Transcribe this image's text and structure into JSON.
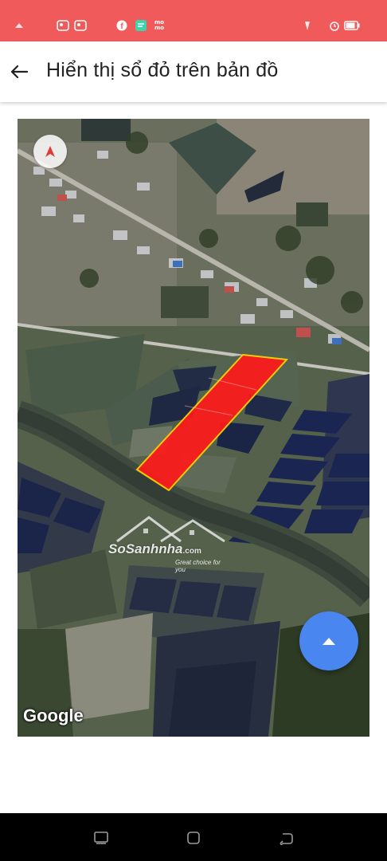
{
  "status_bar": {
    "background": "#f15a5a",
    "left_icons": [
      "notification-icon",
      "photo-icon",
      "photo-icon",
      "facebook-icon",
      "message-icon",
      "momo-icon"
    ],
    "momo_label": "mo\nmo",
    "right_icons": [
      "vpn-key-icon",
      "alarm-icon",
      "battery-icon"
    ]
  },
  "app_bar": {
    "back_icon": "arrow-left-icon",
    "title": "Hiển thị sổ đỏ trên bản đồ"
  },
  "map": {
    "view": "satellite",
    "compass_icon": "compass-icon",
    "google_logo": "Google",
    "watermark": {
      "brand": "SoSanhnha",
      "domain": ".com",
      "tagline": "Great choice for you"
    },
    "parcel_fill": "#ff1a1a",
    "parcel_border": "#ffd400"
  },
  "fab": {
    "icon": "caret-up-icon",
    "color": "#4a86f0"
  },
  "nav_bar": {
    "buttons": [
      "recent-apps-icon",
      "home-icon",
      "back-icon"
    ]
  }
}
